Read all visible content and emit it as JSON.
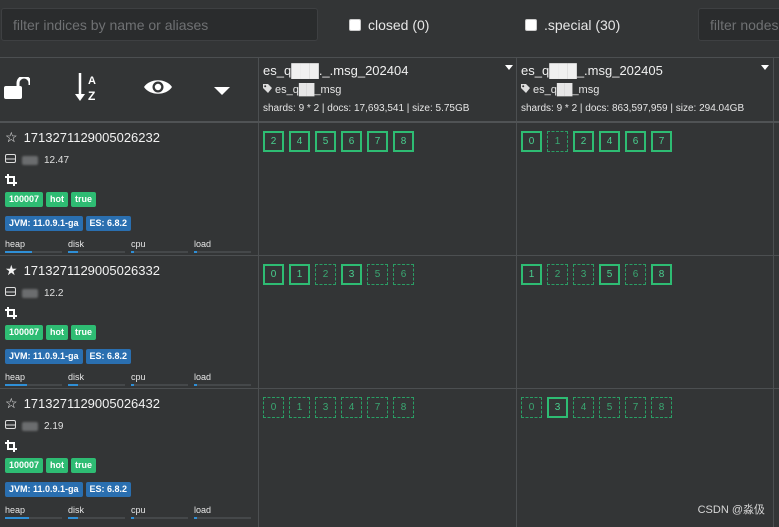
{
  "filters": {
    "indices_placeholder": "filter indices by name or aliases",
    "closed_label": "closed (0)",
    "special_label": ".special (30)",
    "nodes_placeholder": "filter nodes"
  },
  "toolbar": {
    "icons": [
      "unlock-icon",
      "sort-alpha-icon",
      "eye-icon",
      "caret-down-icon"
    ]
  },
  "indices": [
    {
      "name": "es_q███._.msg_202404",
      "alias": "es_q██_msg",
      "stats": "shards: 9 * 2 | docs: 17,693,541 | size: 5.75GB"
    },
    {
      "name": "es_q███_.msg_202405",
      "alias": "es_q██_msg",
      "stats": "shards: 9 * 2 | docs: 863,597,959 | size: 294.04GB"
    }
  ],
  "nodes": [
    {
      "name": "1713271129005026232",
      "star": "☆",
      "ip": "12.47",
      "badges": [
        "100007",
        "hot",
        "true"
      ],
      "jvm": "JVM: 11.0.9.1-ga",
      "es": "ES: 6.8.2",
      "metrics": [
        {
          "label": "heap",
          "value": 0.48
        },
        {
          "label": "disk",
          "value": 0.18
        },
        {
          "label": "cpu",
          "value": 0.05
        },
        {
          "label": "load",
          "value": 0.05
        }
      ],
      "shards": [
        [
          {
            "n": "2",
            "p": true
          },
          {
            "n": "4",
            "p": true
          },
          {
            "n": "5",
            "p": true
          },
          {
            "n": "6",
            "p": true
          },
          {
            "n": "7",
            "p": true
          },
          {
            "n": "8",
            "p": true
          }
        ],
        [
          {
            "n": "0",
            "p": true
          },
          {
            "n": "1",
            "p": false
          },
          {
            "n": "2",
            "p": true
          },
          {
            "n": "4",
            "p": true
          },
          {
            "n": "6",
            "p": true
          },
          {
            "n": "7",
            "p": true
          }
        ]
      ]
    },
    {
      "name": "1713271129005026332",
      "star": "★",
      "ip": "12.2",
      "badges": [
        "100007",
        "hot",
        "true"
      ],
      "jvm": "JVM: 11.0.9.1-ga",
      "es": "ES: 6.8.2",
      "metrics": [
        {
          "label": "heap",
          "value": 0.38
        },
        {
          "label": "disk",
          "value": 0.18
        },
        {
          "label": "cpu",
          "value": 0.05
        },
        {
          "label": "load",
          "value": 0.05
        }
      ],
      "shards": [
        [
          {
            "n": "0",
            "p": true
          },
          {
            "n": "1",
            "p": true
          },
          {
            "n": "2",
            "p": false
          },
          {
            "n": "3",
            "p": true
          },
          {
            "n": "5",
            "p": false
          },
          {
            "n": "6",
            "p": false
          }
        ],
        [
          {
            "n": "1",
            "p": true
          },
          {
            "n": "2",
            "p": false
          },
          {
            "n": "3",
            "p": false
          },
          {
            "n": "5",
            "p": true
          },
          {
            "n": "6",
            "p": false
          },
          {
            "n": "8",
            "p": true
          }
        ]
      ]
    },
    {
      "name": "1713271129005026432",
      "star": "☆",
      "ip": "2.19",
      "badges": [
        "100007",
        "hot",
        "true"
      ],
      "jvm": "JVM: 11.0.9.1-ga",
      "es": "ES: 6.8.2",
      "metrics": [
        {
          "label": "heap",
          "value": 0.42
        },
        {
          "label": "disk",
          "value": 0.18
        },
        {
          "label": "cpu",
          "value": 0.05
        },
        {
          "label": "load",
          "value": 0.05
        }
      ],
      "shards": [
        [
          {
            "n": "0",
            "p": false
          },
          {
            "n": "1",
            "p": false
          },
          {
            "n": "3",
            "p": false
          },
          {
            "n": "4",
            "p": false
          },
          {
            "n": "7",
            "p": false
          },
          {
            "n": "8",
            "p": false
          }
        ],
        [
          {
            "n": "0",
            "p": false
          },
          {
            "n": "3",
            "p": true
          },
          {
            "n": "4",
            "p": false
          },
          {
            "n": "5",
            "p": false
          },
          {
            "n": "7",
            "p": false
          },
          {
            "n": "8",
            "p": false
          }
        ]
      ]
    }
  ],
  "colors": {
    "background": "#333536",
    "primary_shard": "#2ebc73",
    "badge_green": "#2ebc73",
    "badge_blue": "#2a6fb0",
    "metric_bar": "#2f8fd6"
  },
  "watermark": "CSDN @淼伋"
}
